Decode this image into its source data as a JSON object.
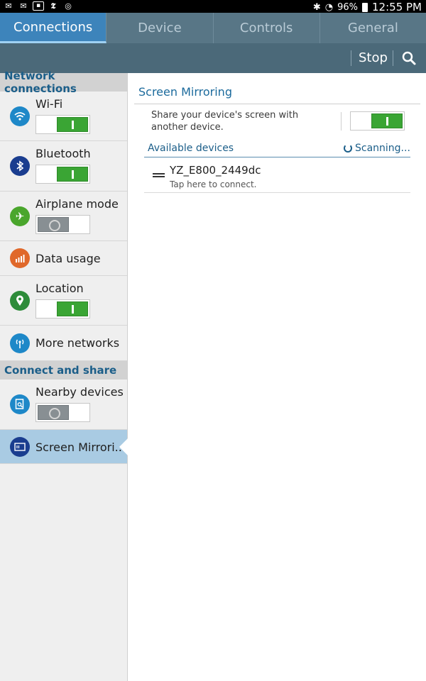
{
  "status_bar": {
    "battery": "96%",
    "time": "12:55 PM"
  },
  "tabs": [
    {
      "label": "Connections",
      "active": true
    },
    {
      "label": "Device",
      "active": false
    },
    {
      "label": "Controls",
      "active": false
    },
    {
      "label": "General",
      "active": false
    }
  ],
  "action_bar": {
    "stop_label": "Stop",
    "search_icon": "search-icon"
  },
  "sidebar": {
    "sections": [
      {
        "header": "Network connections"
      },
      {
        "header": "Connect and share"
      }
    ],
    "items": [
      {
        "label": "Wi-Fi",
        "icon": "wifi-icon",
        "color": "#1e88c8",
        "toggle": "on"
      },
      {
        "label": "Bluetooth",
        "icon": "bluetooth-icon",
        "color": "#1a3d8f",
        "toggle": "on"
      },
      {
        "label": "Airplane mode",
        "icon": "airplane-icon",
        "color": "#4aa62c",
        "toggle": "off"
      },
      {
        "label": "Data usage",
        "icon": "bar-chart-icon",
        "color": "#e0682a"
      },
      {
        "label": "Location",
        "icon": "location-pin-icon",
        "color": "#2e8c3a",
        "toggle": "on"
      },
      {
        "label": "More networks",
        "icon": "antenna-icon",
        "color": "#1e88c8"
      },
      {
        "label": "Nearby devices",
        "icon": "search-file-icon",
        "color": "#1e88c8",
        "toggle": "off"
      },
      {
        "label": "Screen Mirrori..",
        "icon": "screen-mirror-icon",
        "color": "#1a3d8f",
        "selected": true
      }
    ]
  },
  "main": {
    "title": "Screen Mirroring",
    "description": "Share your device's screen with another device.",
    "toggle": "on",
    "available_header": "Available devices",
    "scanning_label": "Scanning...",
    "devices": [
      {
        "name": "YZ_E800_2449dc",
        "subtitle": "Tap here to connect."
      }
    ]
  },
  "colors": {
    "accent": "#3d84bb",
    "toggle_on": "#3aa534",
    "section_text": "#1b5e89"
  }
}
